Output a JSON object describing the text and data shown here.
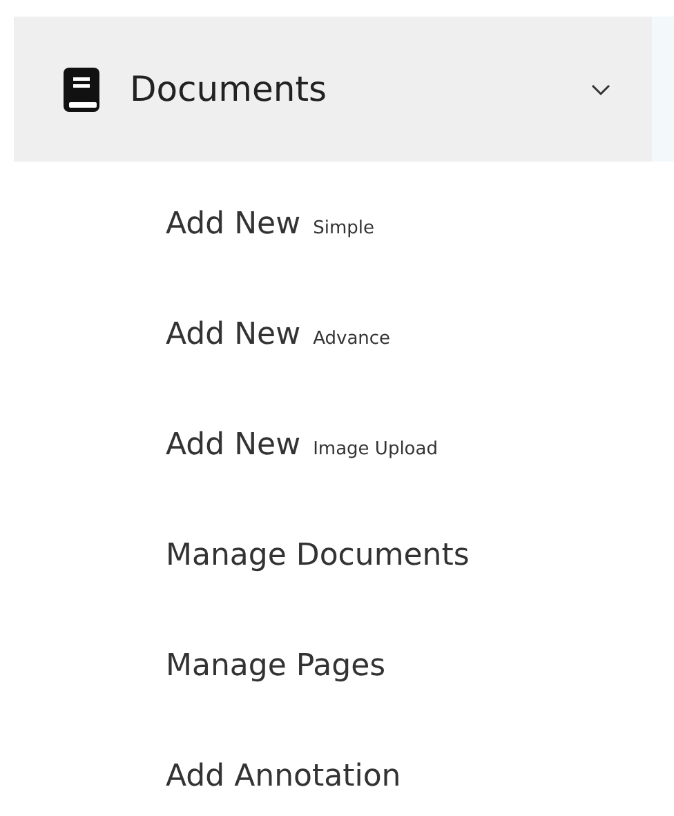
{
  "menu": {
    "label": "Documents",
    "expanded": true,
    "items": [
      {
        "label": "Add New",
        "note": "Simple"
      },
      {
        "label": "Add New",
        "note": "Advance"
      },
      {
        "label": "Add New",
        "note": "Image Upload"
      },
      {
        "label": "Manage Documents"
      },
      {
        "label": "Manage Pages"
      },
      {
        "label": "Add Annotation"
      }
    ]
  }
}
